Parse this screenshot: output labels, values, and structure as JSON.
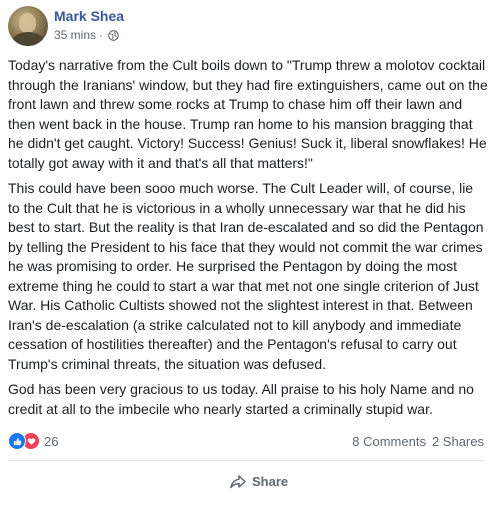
{
  "post": {
    "author": "Mark Shea",
    "timestamp": "35 mins",
    "separator": "·",
    "privacy_icon": "globe-icon",
    "paragraphs": [
      "Today's narrative from the Cult boils down to \"Trump threw a molotov cocktail through the Iranians' window, but they had fire extinguishers, came out on the front lawn and threw some rocks at Trump to chase him off their lawn and then went back in the house. Trump ran home to his mansion bragging that he didn't get caught. Victory! Success! Genius! Suck it, liberal snowflakes! He totally got away with it and that's all that matters!\"",
      "This could have been sooo much worse. The Cult Leader will, of course, lie to the Cult that he is victorious in a wholly unnecessary war that he did his best to start. But the reality is that Iran de-escalated and so did the Pentagon by telling the President to his face that they would not commit the war crimes he was promising to order. He surprised the Pentagon by doing the most extreme thing he could to start a war that met not one single criterion of Just War. His Catholic Cultists showed not the slightest interest in that. Between Iran's de-escalation (a strike calculated not to kill anybody and immediate cessation of hostilities thereafter) and the Pentagon's refusal to carry out Trump's criminal threats, the situation was defused.",
      "God has been very gracious to us today. All praise to his holy Name and no credit at all to the imbecile who nearly started a criminally stupid war."
    ]
  },
  "reactions": {
    "icons": [
      "like-icon",
      "love-icon"
    ],
    "count": "26",
    "comments": "8 Comments",
    "shares": "2 Shares"
  },
  "actions": {
    "share_label": "Share"
  },
  "colors": {
    "author": "#385898",
    "meta": "#606770",
    "like": "#1877f2",
    "love": "#f33e58"
  }
}
